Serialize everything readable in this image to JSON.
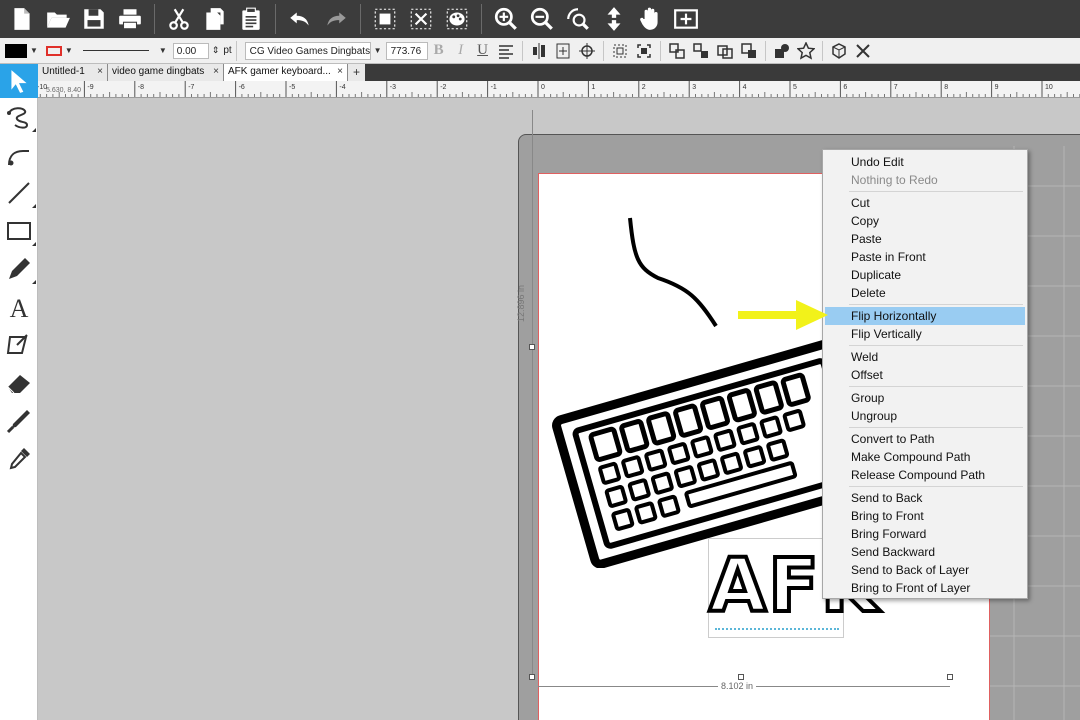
{
  "toolbar": {
    "icons": [
      "new-file",
      "open-folder",
      "save",
      "print",
      "cut",
      "copy",
      "paste",
      "undo",
      "redo",
      "group-select",
      "deselect",
      "color-palette",
      "zoom-in",
      "zoom-out",
      "zoom-select",
      "move-arrows",
      "pan-hand",
      "fit-page"
    ]
  },
  "format_bar": {
    "line_width": "0.00",
    "line_unit": "pt",
    "font_name": "CG Video Games Dingbats",
    "font_size": "773.76",
    "bold": "B",
    "italic": "I",
    "underline": "U"
  },
  "tabs": [
    {
      "label": "Untitled-1"
    },
    {
      "label": "video game dingbats"
    },
    {
      "label": "AFK gamer keyboard..."
    }
  ],
  "ruler": {
    "coord": "5.630, 8.40",
    "ticks": [
      "-10",
      "-9",
      "-8",
      "-7",
      "-6",
      "-5",
      "-4",
      "-3",
      "-2",
      "-1",
      "0",
      "1",
      "2",
      "3",
      "4",
      "5",
      "6",
      "7",
      "8",
      "9",
      "10"
    ]
  },
  "canvas": {
    "height_label": "12.896 in",
    "width_label": "8.102 in",
    "afk_text": "AFK"
  },
  "context_menu": {
    "groups": [
      [
        {
          "label": "Undo Edit"
        },
        {
          "label": "Nothing to Redo",
          "disabled": true
        }
      ],
      [
        {
          "label": "Cut"
        },
        {
          "label": "Copy"
        },
        {
          "label": "Paste"
        },
        {
          "label": "Paste in Front"
        },
        {
          "label": "Duplicate"
        },
        {
          "label": "Delete"
        }
      ],
      [
        {
          "label": "Flip Horizontally",
          "hover": true
        },
        {
          "label": "Flip Vertically"
        }
      ],
      [
        {
          "label": "Weld"
        },
        {
          "label": "Offset"
        }
      ],
      [
        {
          "label": "Group"
        },
        {
          "label": "Ungroup"
        }
      ],
      [
        {
          "label": "Convert to Path"
        },
        {
          "label": "Make Compound Path"
        },
        {
          "label": "Release Compound Path"
        }
      ],
      [
        {
          "label": "Send to Back"
        },
        {
          "label": "Bring to Front"
        },
        {
          "label": "Bring Forward"
        },
        {
          "label": "Send Backward"
        },
        {
          "label": "Send to Back of Layer"
        },
        {
          "label": "Bring to Front of Layer"
        }
      ]
    ]
  },
  "colors": {
    "accent": "#2aa3e8",
    "menu_hover": "#99ccf2",
    "annotation_arrow": "#f2f21a"
  }
}
